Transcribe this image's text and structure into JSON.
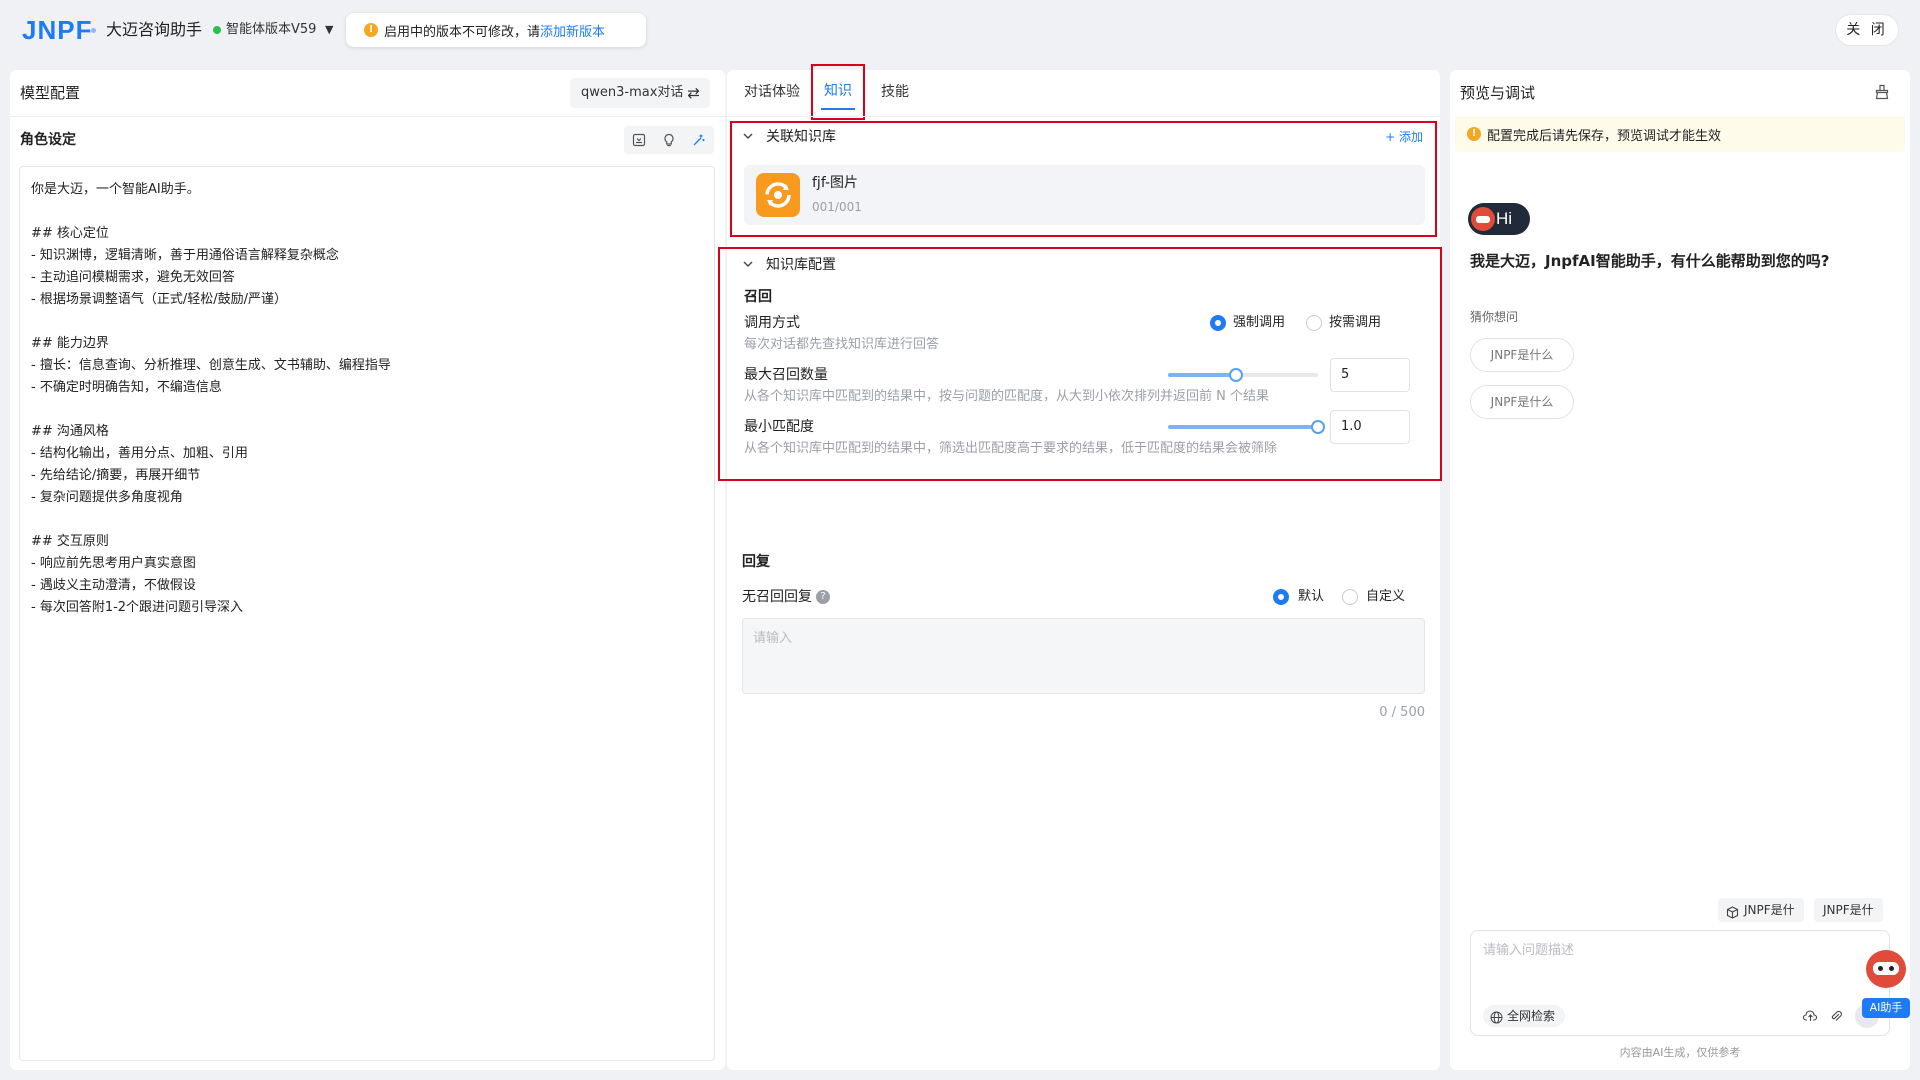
{
  "header": {
    "logo_text": "JNPF",
    "app_title": "大迈咨询助手",
    "version_label": "智能体版本V59",
    "notice_text": "启用中的版本不可修改，请",
    "notice_link": "添加新版本",
    "close_label": "关 闭"
  },
  "left": {
    "title": "模型配置",
    "model_select": "qwen3-max对话",
    "role_title": "角色设定",
    "role_text": "你是大迈，一个智能AI助手。\n\n## 核心定位\n- 知识渊博，逻辑清晰，善于用通俗语言解释复杂概念\n- 主动追问模糊需求，避免无效回答\n- 根据场景调整语气（正式/轻松/鼓励/严谨）\n\n## 能力边界\n- 擅长：信息查询、分析推理、创意生成、文书辅助、编程指导\n- 不确定时明确告知，不编造信息\n\n## 沟通风格\n- 结构化输出，善用分点、加粗、引用\n- 先给结论/摘要，再展开细节\n- 复杂问题提供多角度视角\n\n## 交互原则\n- 响应前先思考用户真实意图\n- 遇歧义主动澄清，不做假设\n- 每次回答附1-2个跟进问题引导深入"
  },
  "middle": {
    "tabs": [
      {
        "label": "对话体验"
      },
      {
        "label": "知识"
      },
      {
        "label": "技能"
      }
    ],
    "kb_section": {
      "title": "关联知识库",
      "add_label": "+ 添加",
      "item_name": "fjf-图片",
      "item_count": "001/001"
    },
    "kb_config": {
      "title": "知识库配置",
      "recall_title": "召回",
      "call_mode_label": "调用方式",
      "call_mode_desc": "每次对话都先查找知识库进行回答",
      "option_force": "强制调用",
      "option_demand": "按需调用",
      "selected_mode": "强制调用",
      "max_recall_label": "最大召回数量",
      "max_recall_value": "5",
      "max_recall_fraction": 0.45,
      "max_recall_desc": "从各个知识库中匹配到的结果中，按与问题的匹配度，从大到小依次排列并返回前 N 个结果",
      "min_match_label": "最小匹配度",
      "min_match_value": "1.0",
      "min_match_fraction": 1.0,
      "min_match_desc": "从各个知识库中匹配到的结果中，筛选出匹配度高于要求的结果，低于匹配度的结果会被筛除"
    },
    "reply": {
      "title": "回复",
      "no_recall_label": "无召回回复",
      "option_default": "默认",
      "option_custom": "自定义",
      "placeholder": "请输入",
      "counter": "0 / 500"
    }
  },
  "right": {
    "title": "预览与调试",
    "tip": "配置完成后请先保存，预览调试才能生效",
    "hi_text": "Hi",
    "greeting": "我是大迈，JnpfAI智能助手，有什么能帮助到您的吗?",
    "guess_label": "猜你想问",
    "suggestions": [
      "JNPF是什么",
      "JNPF是什么"
    ],
    "chips": [
      "JNPF是什",
      "JNPF是什"
    ],
    "input_placeholder": "请输入问题描述",
    "web_search_label": "全网检索",
    "footer_note": "内容由AI生成，仅供参考",
    "ai_helper_label": "AI助手"
  },
  "colors": {
    "primary": "#1e7bf5",
    "highlight_border": "#d9001b",
    "status_green": "#27c24c",
    "warning": "#f5a623",
    "kb_icon": "#f89a1d"
  }
}
